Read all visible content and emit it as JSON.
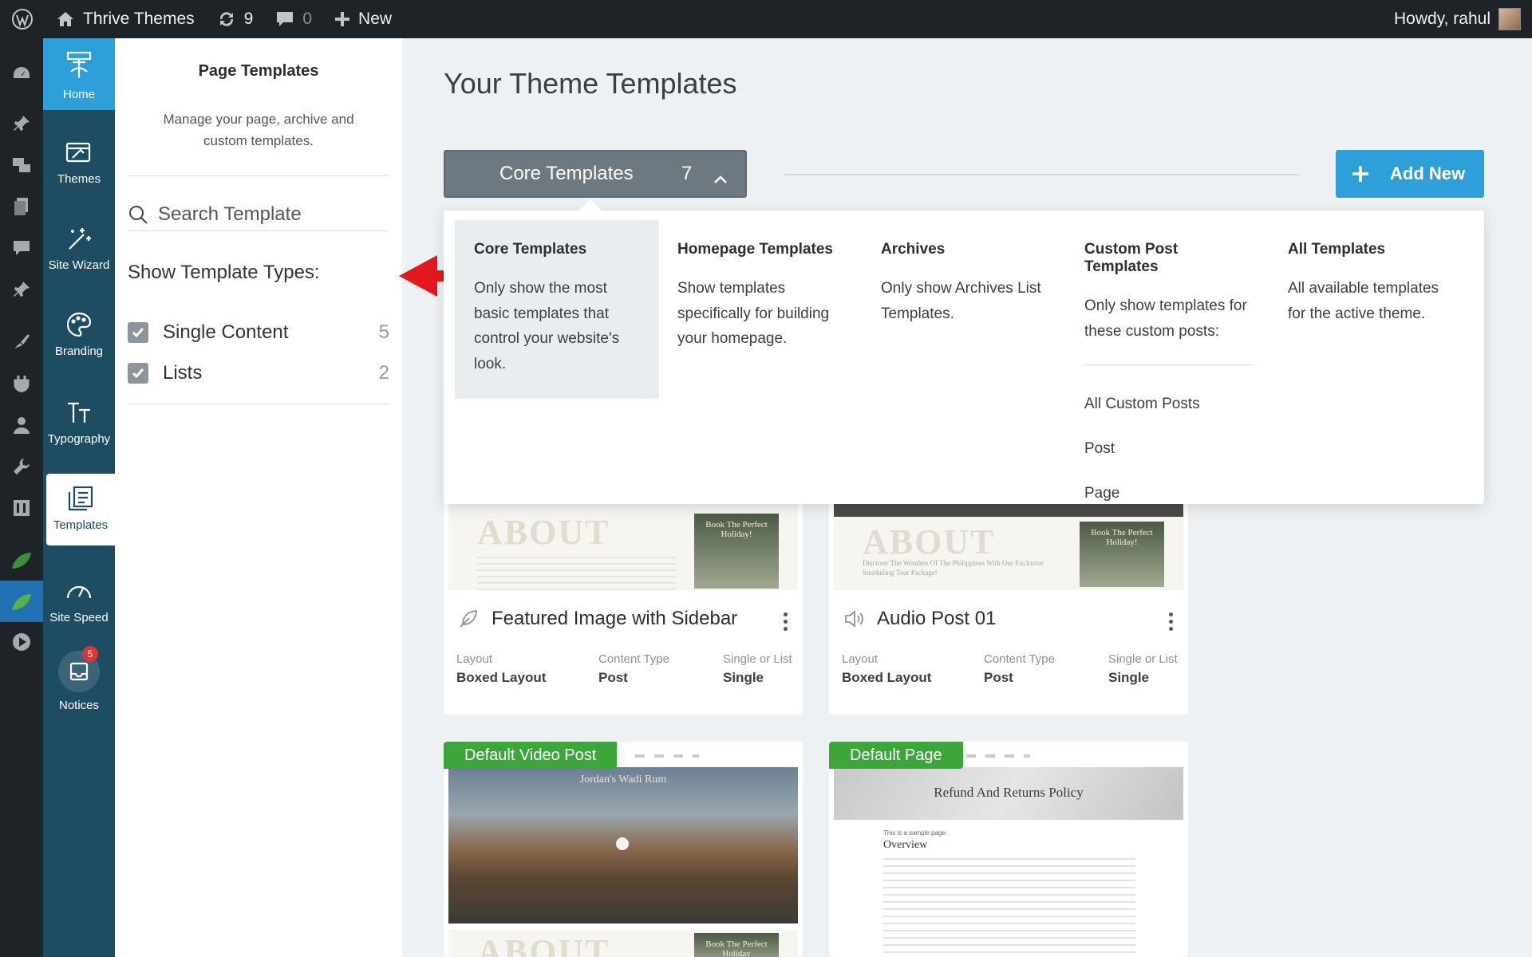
{
  "adminbar": {
    "site_name": "Thrive Themes",
    "updates_count": "9",
    "comments_count": "0",
    "new_label": "New",
    "greeting": "Howdy, rahul"
  },
  "wp_rail": {
    "icons": [
      "dashboard-icon",
      "pin-icon",
      "media-icon",
      "pages-icon",
      "comments-icon",
      "pin-icon",
      "appearance-icon",
      "plugins-icon",
      "users-icon",
      "tools-icon",
      "settings-icon",
      "leaf-icon",
      "leaf-icon",
      "play-icon"
    ]
  },
  "thrive_nav": {
    "home": "Home",
    "themes": "Themes",
    "site_wizard": "Site Wizard",
    "branding": "Branding",
    "typography": "Typography",
    "templates": "Templates",
    "site_speed": "Site Speed",
    "notices": "Notices",
    "notices_badge": "5"
  },
  "filter_panel": {
    "title": "Page Templates",
    "description": "Manage your page, archive and custom templates.",
    "search_placeholder": "Search Template",
    "types_heading": "Show Template Types:",
    "types": [
      {
        "label": "Single Content",
        "count": "5",
        "checked": true
      },
      {
        "label": "Lists",
        "count": "2",
        "checked": true
      }
    ]
  },
  "main": {
    "title": "Your Theme Templates",
    "core_button": {
      "label": "Core Templates",
      "count": "7"
    },
    "add_new": "Add New"
  },
  "dropdown": {
    "columns": [
      {
        "title": "Core Templates",
        "desc": "Only show the most basic templates that control your website's look."
      },
      {
        "title": "Homepage Templates",
        "desc": "Show templates specifically for building your homepage."
      },
      {
        "title": "Archives",
        "desc": "Only show Archives List Templates."
      },
      {
        "title": "Custom Post Templates",
        "desc": "Only show templates for these custom posts:",
        "links": [
          "All Custom Posts",
          "Post",
          "Page"
        ]
      },
      {
        "title": "All Templates",
        "desc": "All available templates for the active theme."
      }
    ]
  },
  "cards": [
    {
      "title": "Featured Image with Sidebar",
      "meta": [
        {
          "label": "Layout",
          "value": "Boxed Layout"
        },
        {
          "label": "Content Type",
          "value": "Post"
        },
        {
          "label": "Single or List",
          "value": "Single"
        }
      ],
      "thumb_heading": "ABOUT",
      "thumb_box": "Book The Perfect Holiday!"
    },
    {
      "title": "Audio Post 01",
      "meta": [
        {
          "label": "Layout",
          "value": "Boxed Layout"
        },
        {
          "label": "Content Type",
          "value": "Post"
        },
        {
          "label": "Single or List",
          "value": "Single"
        }
      ],
      "thumb_heading": "ABOUT",
      "thumb_sub": "Discover The Wonders Of The Philippines With Our Exclusive Snorkeling Tour Package!",
      "thumb_box": "Book The Perfect Holiday!"
    },
    {
      "tag": "Default Video Post",
      "thumb_caption": "Jordan's Wadi Rum",
      "thumb_heading": "ABOUT",
      "thumb_box": "Book The Perfect Holiday"
    },
    {
      "tag": "Default Page",
      "page_title": "Refund And Returns Policy",
      "page_intro": "This is a sample page.",
      "page_heading": "Overview"
    }
  ],
  "colors": {
    "admin_bar": "#1d2327",
    "thrive_sidebar": "#1e4d63",
    "accent_blue": "#2e9fd8",
    "tag_green": "#3ca63a",
    "arrow_red": "#e3191f"
  }
}
